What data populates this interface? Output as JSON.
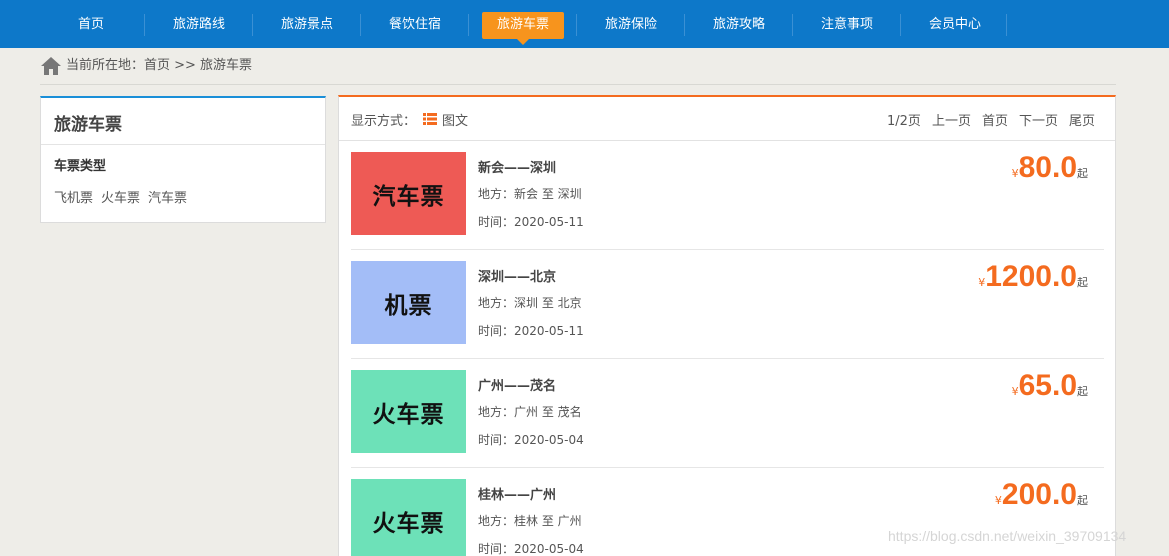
{
  "nav": {
    "items": [
      {
        "label": "首页"
      },
      {
        "label": "旅游路线"
      },
      {
        "label": "旅游景点"
      },
      {
        "label": "餐饮住宿"
      },
      {
        "label": "旅游车票"
      },
      {
        "label": "旅游保险"
      },
      {
        "label": "旅游攻略"
      },
      {
        "label": "注意事项"
      },
      {
        "label": "会员中心"
      }
    ],
    "active_index": 4
  },
  "breadcrumb": {
    "text": "当前所在地：首页 >> 旅游车票"
  },
  "sidebar": {
    "title": "旅游车票",
    "subtitle": "车票类型",
    "links": [
      "飞机票",
      "火车票",
      "汽车票"
    ]
  },
  "toolbar": {
    "display_label": "显示方式：",
    "display_mode": "图文",
    "pager": {
      "page_info": "1/2页",
      "prev": "上一页",
      "first": "首页",
      "next": "下一页",
      "last": "尾页"
    }
  },
  "items": [
    {
      "thumb_text": "汽车票",
      "thumb_color": "#ee5a55",
      "title": "新会——深圳",
      "place": "地方：新会 至 深圳",
      "time": "时间：2020-05-11",
      "currency": "¥",
      "price": "80.0",
      "suffix": "起"
    },
    {
      "thumb_text": "机票",
      "thumb_color": "#a3bdf7",
      "title": "深圳——北京",
      "place": "地方：深圳 至 北京",
      "time": "时间：2020-05-11",
      "currency": "¥",
      "price": "1200.0",
      "suffix": "起"
    },
    {
      "thumb_text": "火车票",
      "thumb_color": "#6de1b8",
      "title": "广州——茂名",
      "place": "地方：广州 至 茂名",
      "time": "时间：2020-05-04",
      "currency": "¥",
      "price": "65.0",
      "suffix": "起"
    },
    {
      "thumb_text": "火车票",
      "thumb_color": "#6de1b8",
      "title": "桂林——广州",
      "place": "地方：桂林 至 广州",
      "time": "时间：2020-05-04",
      "currency": "¥",
      "price": "200.0",
      "suffix": "起"
    }
  ],
  "watermark": "https://blog.csdn.net/weixin_39709134",
  "colors": {
    "nav_bg": "#0d78c9",
    "nav_active": "#f7941d",
    "price": "#f46b1f",
    "side_accent": "#1a8fd8"
  }
}
